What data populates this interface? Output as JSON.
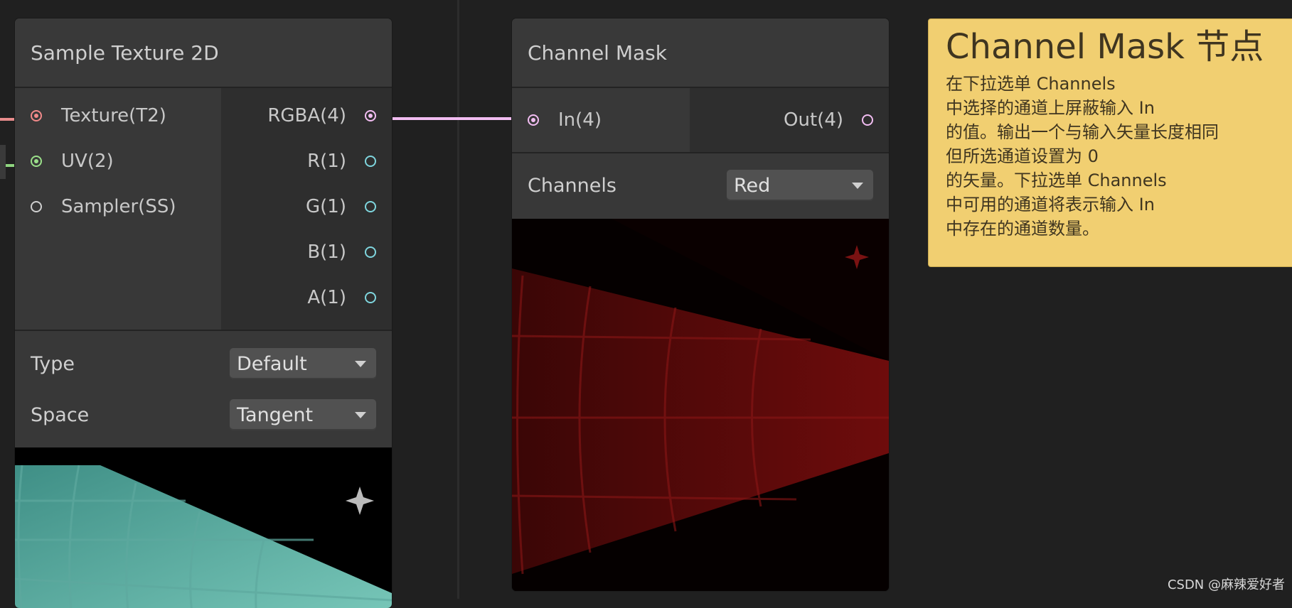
{
  "node_sample": {
    "title": "Sample Texture 2D",
    "inputs": [
      "Texture(T2)",
      "UV(2)",
      "Sampler(SS)"
    ],
    "outputs": [
      "RGBA(4)",
      "R(1)",
      "G(1)",
      "B(1)",
      "A(1)"
    ],
    "type_label": "Type",
    "type_value": "Default",
    "space_label": "Space",
    "space_value": "Tangent"
  },
  "node_mask": {
    "title": "Channel Mask",
    "input": "In(4)",
    "output": "Out(4)",
    "channels_label": "Channels",
    "channels_value": "Red"
  },
  "note": {
    "title": "Channel Mask 节点",
    "lines": [
      "在下拉选单 Channels",
      "中选择的通道上屏蔽输入 In",
      "的值。输出一个与输入矢量长度相同",
      "但所选通道设置为 0",
      "的矢量。下拉选单 Channels",
      "中可用的通道将表示输入 In",
      "中存在的通道数量。"
    ]
  },
  "watermark": "CSDN @麻辣爱好者",
  "colors": {
    "texture_port": "#f28a8a",
    "uv_port": "#9be08a",
    "vector4_port": "#f2bdf2",
    "float_port": "#7fd6de",
    "wire_rgba": "#f2bdf2",
    "note_bg": "#f1cf71"
  }
}
